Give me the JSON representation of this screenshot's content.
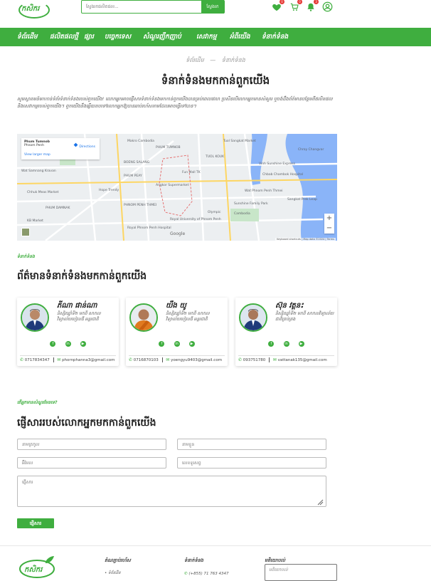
{
  "header": {
    "logo_text": "កសិករ",
    "search_placeholder": "ស្វែងរកផលិតផល...",
    "search_button": "ស្វែងរក",
    "wishlist_count": "0",
    "cart_count": "0",
    "notification_count": "3"
  },
  "nav": {
    "items": [
      "ទំព័រដើម",
      "ផលិតផលថ្មី",
      "ផ្សារ",
      "បច្ចេកទេស",
      "សំណួរញឹកញាប់",
      "សេវាកម្ម",
      "អំពីយើង",
      "ទំនាក់ទំនង"
    ]
  },
  "breadcrumb": {
    "home": "ទំព័រដើម",
    "separator": "—",
    "current": "ទំនាក់ទំនង"
  },
  "page_title": "ទំនាក់ទំនងមកកាន់ពួកយើង",
  "intro_text": "សូមស្វាគមន៍មកកាន់ទំព័រទំនាក់ទំនងរបស់ពួកយើង! លោកអ្នកអាចផ្ញើសារទំនាក់ទំនងមកកាន់ពួកយើងបានគ្រប់ពេលវេលា ប្រសិនបើលោកអ្នកមានសំណួរ ឬចង់ដឹងព័ត៌មានបន្ថែមពីផលិតផល និងសេវាកម្មរបស់ពួកយើង។ ពួកយើងនឹងឆ្លើយតបទៅលោកអ្នកឱ្យបានឆាប់រហ័សតាមដែលអាចធ្វើទៅបាន។",
  "map": {
    "place_name": "Phum Tumnob",
    "place_sub": "Phnom Penh",
    "view_larger": "View larger map",
    "directions": "Directions",
    "zoom_in": "+",
    "zoom_out": "−",
    "attribution": "Keyboard shortcuts | Map data ©2024 | Terms",
    "google": "Google",
    "labels": {
      "l1": "Makro Cambodia",
      "l2": "Wat Samnang Kravan",
      "l3": "PHUM TUMNOB",
      "l4": "Fun Mall TK",
      "l5": "Chbab Chambok Hospital",
      "l6": "Hope Trendy",
      "l7": "Chroy Changvar",
      "l8": "Angkor Supermarket",
      "l9": "Sunshine Family Park",
      "l10": "Royal University of Phnom Penh",
      "l11": "Royal Phnom Penh Hospital",
      "l12": "PHNOM PENH THMEI",
      "l13": "Cambodia",
      "l14": "PHUM DAMNAK",
      "l15": "Vinh Sunshine Express",
      "l16": "Wat Phnom Penh Thmei",
      "l17": "BOENG SALANG",
      "l18": "PHUM PEAY",
      "l19": "TUOL KOUK",
      "l20": "Olympic",
      "l21": "Chhuk Meas Market",
      "l22": "Tuol Sangkat Market",
      "l23": "Sangkat Prek Leap",
      "l24": "KB Market"
    }
  },
  "contact_section": {
    "subtitle": "ទំនាក់ទំនង",
    "title": "ព័ត៌មានទំនាក់ទំនងមកកាន់ពួកយើង"
  },
  "team": [
    {
      "name": "ភីណា ផាន់ណា",
      "role": "និស្សិតឆ្នាំទី២ មកពី សាកលវិទ្យាល័យបៀលធី អន្តរជាតិ",
      "phone": "0717834347",
      "email": "phornphanna3@gmail.com",
      "robe_color": "#1e3a7a"
    },
    {
      "name": "យឹង យូ",
      "role": "និស្សិតឆ្នាំទី២ មកពី សាកលវិទ្យាល័យបៀលធី អន្តរជាតិ",
      "phone": "0716870103",
      "email": "yoengyu9403@gmail.com",
      "robe_color": "#e07a1f"
    },
    {
      "name": "ស៊ុន វត្តនះ",
      "role": "និស្សិតឆ្នាំទី២ មកពី សាកលវិទ្យាល័យជាតិគ្រប់គ្រង",
      "phone": "093751780",
      "email": "vattanak135@gmail.com",
      "robe_color": "#1e3a7a"
    }
  ],
  "form_section": {
    "subtitle": "តើអ្នកមានសំណួរមែនទេ?",
    "title": "ផ្ញើសាររបស់លោកអ្នកមកកាន់ពួកយើង",
    "name_placeholder": "នាមត្រកូល",
    "firstname_placeholder": "នាមខ្លួន",
    "email_placeholder": "អ៊ីមែល",
    "phone_placeholder": "លេខទូរសព្ទ",
    "message_placeholder": "ផ្ញើសារ",
    "send_button": "ផ្ញើសារ"
  },
  "footer": {
    "logo_text": "កសិករ",
    "col1_title": "តំណភ្ជាប់រហ័ស",
    "col1_item": "ទំព័រដើម",
    "col2_title": "ទំនាក់ទំនង",
    "col2_item": "(+855) 71 763 4347",
    "col3_title": "មតិយោបល់",
    "col3_placeholder": "មតិយោបល់"
  },
  "colors": {
    "brand_green": "#3fae3f",
    "badge_red": "#e53935"
  }
}
